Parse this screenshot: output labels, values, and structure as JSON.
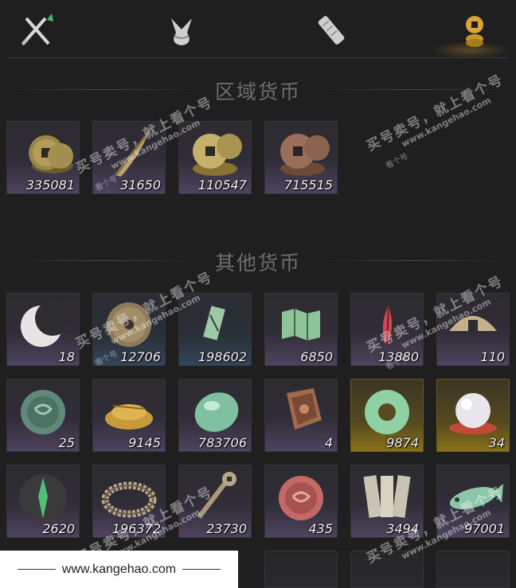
{
  "tabs": [
    {
      "name": "swords-icon",
      "active": false
    },
    {
      "name": "bundle-icon",
      "active": false
    },
    {
      "name": "scroll-icon",
      "active": false
    },
    {
      "name": "coins-icon",
      "active": true
    }
  ],
  "sections": {
    "regional": {
      "title": "区域货币"
    },
    "other": {
      "title": "其他货币"
    }
  },
  "regional_items": [
    {
      "icon": "copper-coin-stack-icon",
      "count": "335081",
      "rarity": "purple"
    },
    {
      "icon": "feather-blade-icon",
      "count": "31650",
      "rarity": "purple"
    },
    {
      "icon": "gold-coin-stack-icon",
      "count": "110547",
      "rarity": "purple"
    },
    {
      "icon": "bronze-coin-stack-icon",
      "count": "715515",
      "rarity": "purple"
    }
  ],
  "other_items": [
    {
      "icon": "crescent-moon-icon",
      "count": "18",
      "rarity": "purple"
    },
    {
      "icon": "round-token-icon",
      "count": "12706",
      "rarity": "blue"
    },
    {
      "icon": "jade-tablet-icon",
      "count": "198602",
      "rarity": "blue"
    },
    {
      "icon": "green-map-icon",
      "count": "6850",
      "rarity": "purple"
    },
    {
      "icon": "red-feather-icon",
      "count": "13880",
      "rarity": "purple"
    },
    {
      "icon": "half-coin-icon",
      "count": "110",
      "rarity": "purple"
    },
    {
      "icon": "jade-seal-icon",
      "count": "25",
      "rarity": "purple"
    },
    {
      "icon": "grain-pile-icon",
      "count": "9145",
      "rarity": "purple"
    },
    {
      "icon": "jade-stone-icon",
      "count": "783706",
      "rarity": "purple"
    },
    {
      "icon": "bronze-plaque-icon",
      "count": "4",
      "rarity": "purple"
    },
    {
      "icon": "jade-ring-icon",
      "count": "9874",
      "rarity": "gold"
    },
    {
      "icon": "pearl-icon",
      "count": "34",
      "rarity": "gold"
    },
    {
      "icon": "green-talisman-icon",
      "count": "2620",
      "rarity": "purple"
    },
    {
      "icon": "beaded-bracelet-icon",
      "count": "196372",
      "rarity": "purple"
    },
    {
      "icon": "coin-sword-icon",
      "count": "23730",
      "rarity": "purple"
    },
    {
      "icon": "red-seal-icon",
      "count": "435",
      "rarity": "purple"
    },
    {
      "icon": "paper-notes-icon",
      "count": "3494",
      "rarity": "purple"
    },
    {
      "icon": "jade-fish-icon",
      "count": "97001",
      "rarity": "purple"
    }
  ],
  "watermarks": {
    "line1": "买号卖号，就上看个号",
    "line2": "www.kangehao.com",
    "line3": "看个号"
  },
  "footer": {
    "url": "www.kangehao.com"
  },
  "colors": {
    "background": "#1f1f20",
    "accent": "#c8962a",
    "gold_slot": "#8a7318",
    "count_text": "#f2f2f2"
  }
}
